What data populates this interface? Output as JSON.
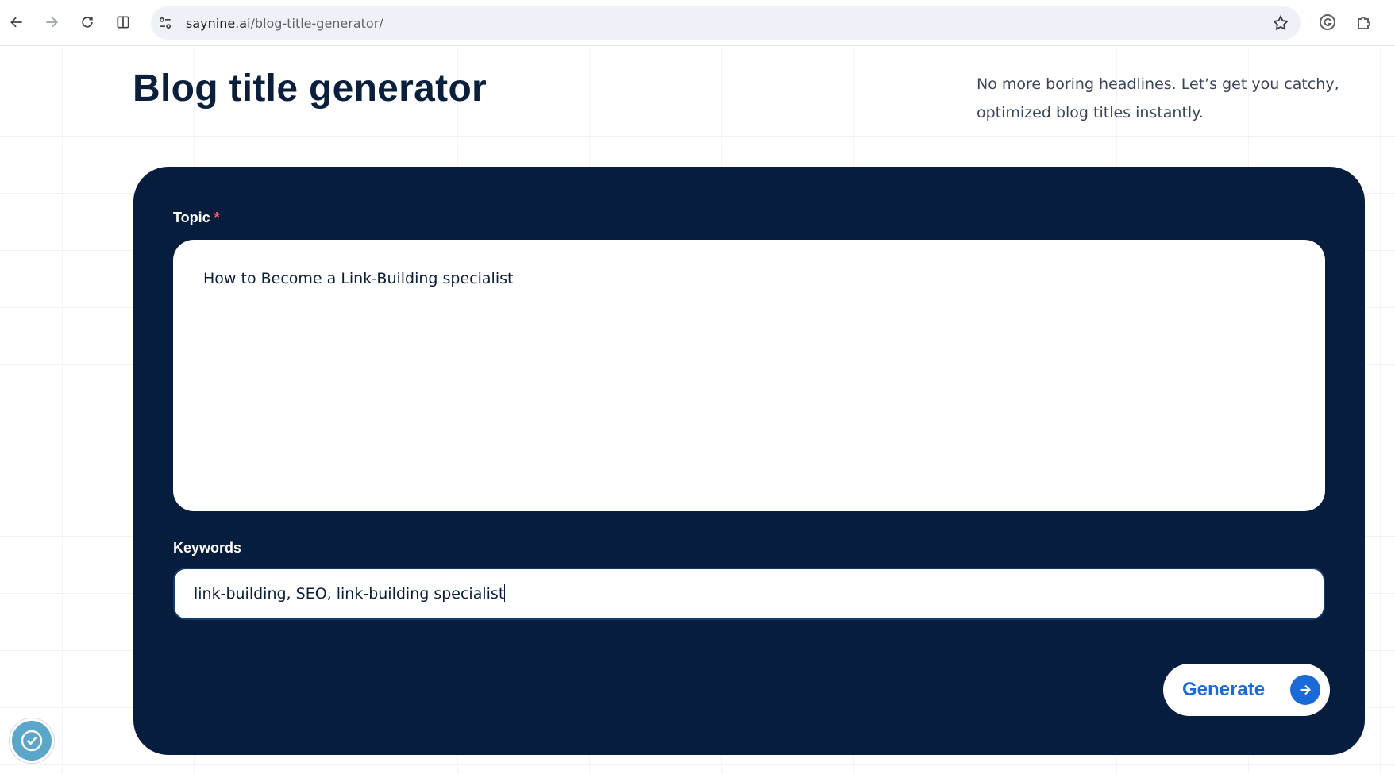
{
  "browser": {
    "url_domain": "saynine.ai",
    "url_path": "/blog-title-generator/"
  },
  "page": {
    "title": "Blog title generator",
    "subtitle": "No more boring headlines. Let’s get you catchy, optimized blog titles instantly."
  },
  "form": {
    "topic_label": "Topic",
    "topic_required_mark": "*",
    "topic_value": "How to Become a Link-Building specialist",
    "keywords_label": "Keywords",
    "keywords_value": "link-building, SEO, link-building specialist",
    "generate_label": "Generate"
  },
  "icons": {
    "back": "arrow-left-icon",
    "forward": "arrow-right-icon",
    "reload": "reload-icon",
    "split": "split-view-icon",
    "site_info": "site-info-icon",
    "bookmark": "star-icon",
    "extension1": "grammarly-icon",
    "extensions": "puzzle-icon",
    "generate_arrow": "arrow-right-circle-icon",
    "accessibility": "accessibility-widget-icon"
  },
  "colors": {
    "card_bg": "#071d3d",
    "accent": "#1a6bd8",
    "required": "#ff5c6c"
  }
}
